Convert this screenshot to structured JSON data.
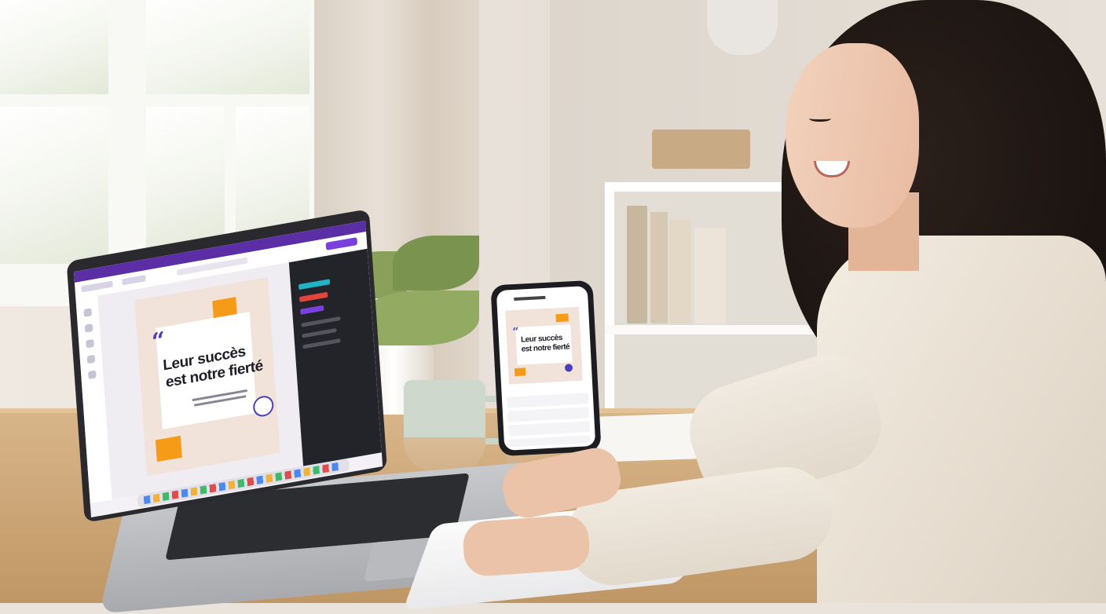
{
  "scene": {
    "description_colors": {
      "brand_purple": "#5b2ea6",
      "quote_accent": "#4a3fb8",
      "orange_accent": "#f59b17",
      "card_peach": "#f1e3d9"
    }
  },
  "laptop": {
    "design_card": {
      "quote_mark": "“",
      "headline_line1": "Leur succès",
      "headline_line2": "est notre fierté"
    }
  },
  "phone": {
    "design_card": {
      "quote_mark": "“",
      "headline_line1": "Leur succès",
      "headline_line2": "est notre fierté"
    }
  }
}
